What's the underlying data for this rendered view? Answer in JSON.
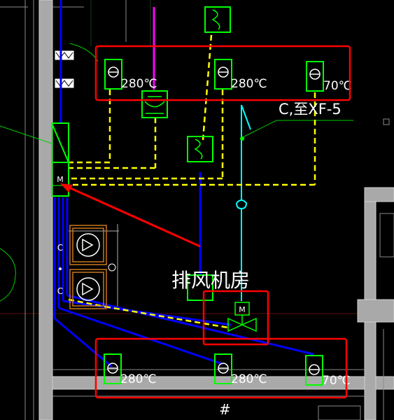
{
  "room_label": "排风机房",
  "annotation": "C,至XF-5",
  "damper_top": [
    {
      "temp": "280℃"
    },
    {
      "temp": "280℃"
    },
    {
      "temp": "70℃"
    }
  ],
  "damper_bottom": [
    {
      "temp": "280℃"
    },
    {
      "temp": "280℃"
    },
    {
      "temp": "70℃"
    }
  ],
  "motor_label": "M",
  "valve_motor_label": "M",
  "fan_letter_upper": "C",
  "fan_letter_lower": "C",
  "grid_mark": "#",
  "colors": {
    "background": "#000000",
    "wall": "#a9a9a9",
    "equipment": "#00ff00",
    "control_dashed": "#ffff00",
    "duct_blue": "#0000ff",
    "water_cyan": "#00ffff",
    "magenta": "#ff00ff",
    "highlight": "#ff0000",
    "fan_casing": "#c8781e"
  }
}
